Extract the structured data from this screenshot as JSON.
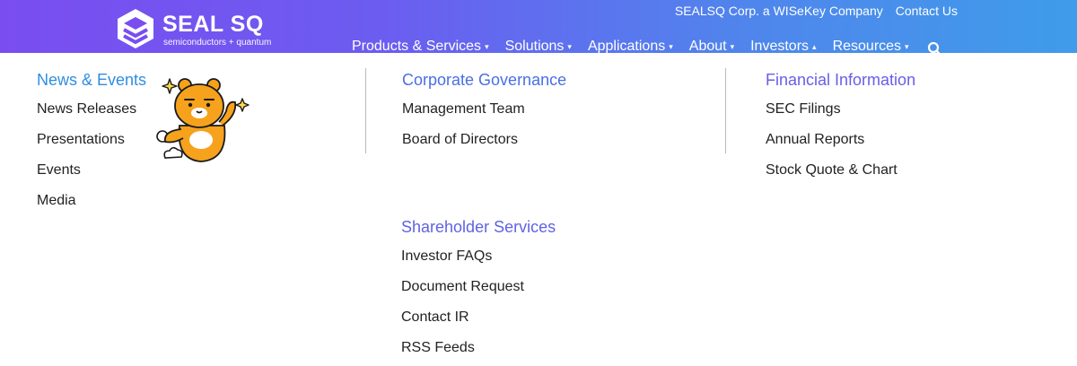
{
  "header": {
    "logo_name": "SEAL SQ",
    "logo_tagline": "semiconductors + quantum",
    "top_links": [
      "SEALSQ Corp. a WISeKey Company",
      "Contact Us"
    ],
    "nav": [
      {
        "label": "Products & Services",
        "caret": "down"
      },
      {
        "label": "Solutions",
        "caret": "down"
      },
      {
        "label": "Applications",
        "caret": "down"
      },
      {
        "label": "About",
        "caret": "down"
      },
      {
        "label": "Investors",
        "caret": "up"
      },
      {
        "label": "Resources",
        "caret": "down"
      }
    ],
    "search_icon": "search-icon"
  },
  "menu": {
    "news_events": {
      "title": "News & Events",
      "links": [
        "News Releases",
        "Presentations",
        "Events",
        "Media"
      ]
    },
    "corporate_governance": {
      "title": "Corporate Governance",
      "links": [
        "Management Team",
        "Board of Directors"
      ]
    },
    "shareholder_services": {
      "title": "Shareholder Services",
      "links": [
        "Investor FAQs",
        "Document Request",
        "Contact IR",
        "RSS Feeds"
      ]
    },
    "financial_information": {
      "title": "Financial Information",
      "links": [
        "SEC Filings",
        "Annual Reports",
        "Stock Quote & Chart"
      ]
    }
  },
  "colors": {
    "news_title": "#2f8ee0",
    "governance_title": "#4a6fe3",
    "shareholder_title": "#5f62e4",
    "financial_title": "#6a5de6",
    "link_text": "#222222",
    "header_start": "#7a4df0",
    "header_end": "#3f9cea"
  },
  "decorations": [
    "bear-mascot-sticker"
  ]
}
